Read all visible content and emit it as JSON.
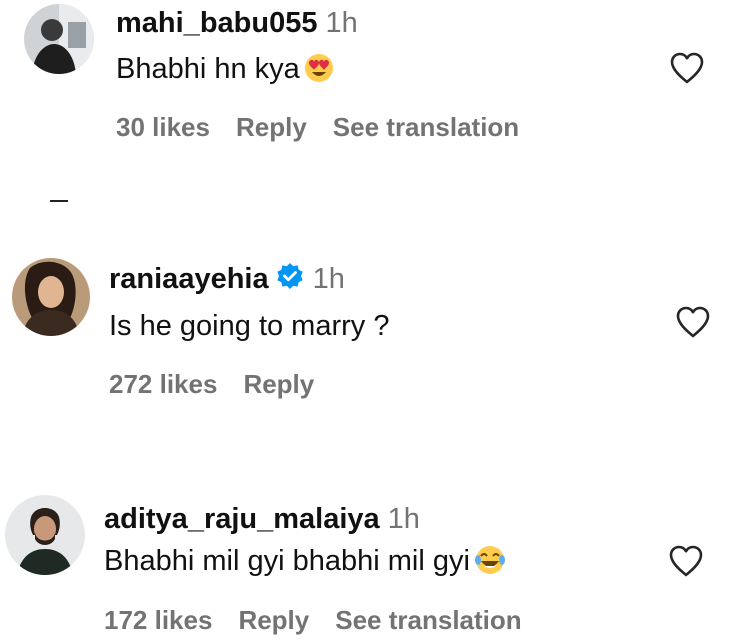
{
  "comments": [
    {
      "username": "mahi_babu055",
      "time": "1h",
      "verified": false,
      "text": "Bhabhi hn kya",
      "emoji_icon": "heart-eyes-emoji",
      "likes": "30 likes",
      "reply": "Reply",
      "translation": "See translation"
    },
    {
      "username": "raniaayehia",
      "time": "1h",
      "verified": true,
      "text": "Is he going to marry ?",
      "likes": "272 likes",
      "reply": "Reply"
    },
    {
      "username": "aditya_raju_malaiya",
      "time": "1h",
      "verified": false,
      "text": "Bhabhi mil gyi bhabhi mil gyi",
      "emoji_icon": "laughing-tears-emoji",
      "likes": "172 likes",
      "reply": "Reply",
      "translation": "See translation"
    }
  ],
  "colors": {
    "text": "#111111",
    "secondary": "#737373",
    "verified": "#0095f6"
  }
}
